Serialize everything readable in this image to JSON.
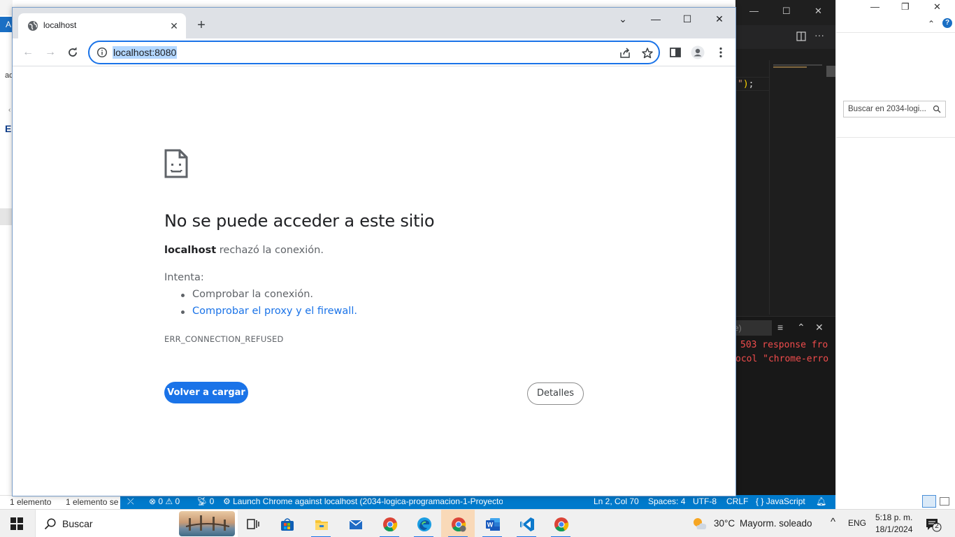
{
  "chrome": {
    "tab_title": "localhost",
    "url": "localhost:8080",
    "error": {
      "title": "No se puede acceder a este sitio",
      "host": "localhost",
      "description_rest": " rechazó la conexión.",
      "try_label": "Intenta:",
      "suggestions": [
        "Comprobar la conexión.",
        "Comprobar el proxy y el firewall."
      ],
      "code": "ERR_CONNECTION_REFUSED",
      "reload_button": "Volver a cargar",
      "details_button": "Detalles"
    }
  },
  "explorer_left": {
    "tab_letter": "A",
    "partial_text": "ad",
    "partial_heading": "E"
  },
  "explorer_right": {
    "search_placeholder": "Buscar en 2034-logi..."
  },
  "vscode": {
    "code_line": {
      "quote": "\"",
      "paren": ")",
      "semi": ";"
    },
    "filter_text": "e)",
    "output_lines": [
      "503 response fro",
      "ocol \"chrome-erro"
    ]
  },
  "statusbar": {
    "items_count": "1 elemento",
    "items_selected": "1 elemento sel",
    "problems_errors": "0",
    "problems_warnings": "0",
    "ports": "0",
    "launch": "Launch Chrome against localhost (2034-logica-programacion-1-Proyecto",
    "cursor": "Ln 2, Col 70",
    "spaces": "Spaces: 4",
    "encoding": "UTF-8",
    "eol": "CRLF",
    "language": "JavaScript"
  },
  "taskbar": {
    "search_label": "Buscar",
    "temperature": "30°C",
    "weather": "Mayorm. soleado",
    "language": "ENG",
    "time": "5:18 p. m.",
    "date": "18/1/2024",
    "notifications": "2",
    "apps": [
      "task-view",
      "microsoft-store",
      "file-explorer",
      "mail",
      "chrome",
      "edge",
      "chrome-profile",
      "word",
      "vscode",
      "chrome"
    ]
  },
  "colors": {
    "accent": "#1a73e8",
    "vscode_status": "#007acc",
    "error_text": "#f14c4c"
  }
}
